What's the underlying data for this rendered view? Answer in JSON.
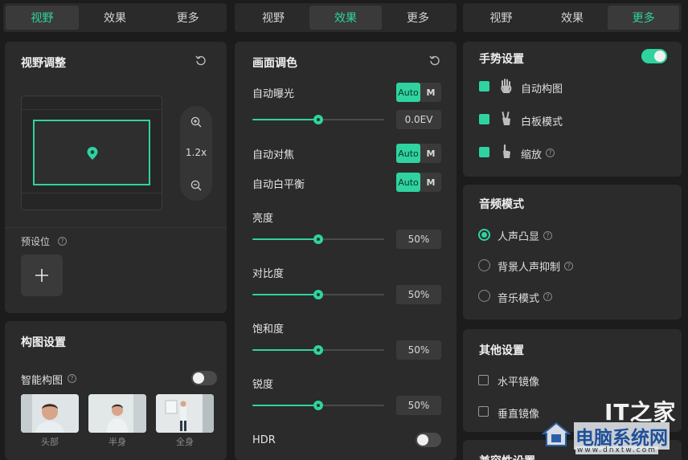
{
  "col1": {
    "tabs": [
      "视野",
      "效果",
      "更多"
    ],
    "active_tab": 0,
    "view_adjust": {
      "title": "视野调整",
      "zoom": "1.2x"
    },
    "preset": {
      "label": "预设位"
    },
    "composition": {
      "title": "构图设置",
      "smart_label": "智能构图",
      "thumbs": [
        "头部",
        "半身",
        "全身"
      ]
    }
  },
  "col2": {
    "tabs": [
      "视野",
      "效果",
      "更多"
    ],
    "active_tab": 1,
    "title": "画面调色",
    "auto_exposure": "自动曝光",
    "exposure_value": "0.0EV",
    "exposure_level": 0.5,
    "auto_focus": "自动对焦",
    "auto_wb": "自动白平衡",
    "auto_label": "Auto",
    "manual_label": "M",
    "brightness": {
      "label": "亮度",
      "value": "50%",
      "level": 0.5
    },
    "contrast": {
      "label": "对比度",
      "value": "50%",
      "level": 0.5
    },
    "saturation": {
      "label": "饱和度",
      "value": "50%",
      "level": 0.5
    },
    "sharpness": {
      "label": "锐度",
      "value": "50%",
      "level": 0.5
    },
    "hdr": "HDR"
  },
  "col3": {
    "tabs": [
      "视野",
      "效果",
      "更多"
    ],
    "active_tab": 2,
    "gesture": {
      "title": "手势设置",
      "items": [
        "自动构图",
        "白板模式",
        "缩放"
      ]
    },
    "audio": {
      "title": "音频模式",
      "options": [
        "人声凸显",
        "背景人声抑制",
        "音乐模式"
      ],
      "selected": 0
    },
    "other": {
      "title": "其他设置",
      "items": [
        "水平镜像",
        "垂直镜像"
      ]
    },
    "partial_title": "兼容性设置"
  },
  "watermark": {
    "brand": "IT之家",
    "text": "电脑系统网",
    "url": "www.dnxtw.com"
  },
  "colors": {
    "accent": "#2fd3a0",
    "panel": "#2b2b2b",
    "background": "#1c1c1c"
  }
}
